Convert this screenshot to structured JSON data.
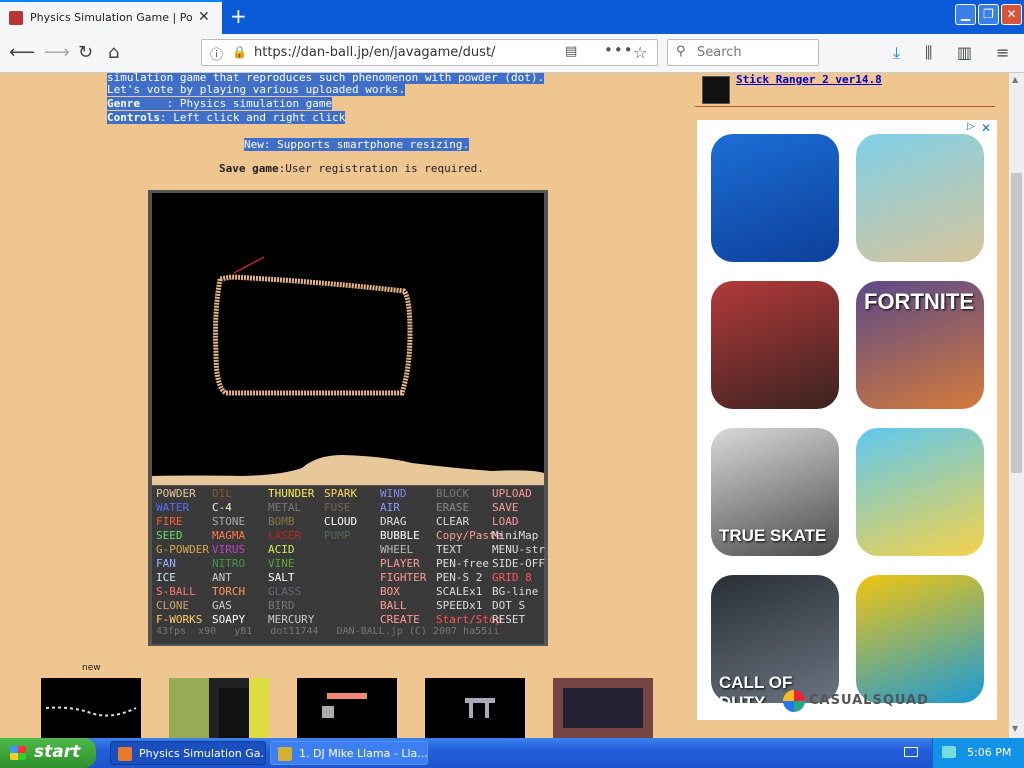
{
  "browser": {
    "tab_title": "Physics Simulation Game | Powder",
    "url": "https://dan-ball.jp/en/javagame/dust/",
    "search_placeholder": "Search"
  },
  "page": {
    "intro_line0": "simulation game that reproduces such phenomenon with powder (dot).",
    "intro_line1": "Let's vote by playing various uploaded works.",
    "genre_label": "Genre    ",
    "genre_value": ": Physics simulation game",
    "controls_label": "Controls",
    "controls_value": ": Left click and right click",
    "new_label": "New",
    "new_value": ": Supports smartphone resizing.",
    "save_label": "Save game",
    "save_value": ":User registration is required.",
    "thumbs_new_label": "new",
    "sidebar_link": "Stick Ranger 2 ver14.8"
  },
  "game": {
    "palette_columns": [
      [
        {
          "label": "POWDER",
          "color": "#e8c79a"
        },
        {
          "label": "WATER",
          "color": "#5a6cff"
        },
        {
          "label": "FIRE",
          "color": "#ff5a3a"
        },
        {
          "label": "SEED",
          "color": "#66dd66"
        },
        {
          "label": "G-POWDER",
          "color": "#d6a84a"
        },
        {
          "label": "FAN",
          "color": "#9ab0ff"
        },
        {
          "label": "ICE",
          "color": "#d6e8ff"
        },
        {
          "label": "S-BALL",
          "color": "#ff7777"
        },
        {
          "label": "CLONE",
          "color": "#d0a070"
        },
        {
          "label": "F-WORKS",
          "color": "#ffcc66"
        }
      ],
      [
        {
          "label": "OIL",
          "color": "#8a5a2a"
        },
        {
          "label": "C-4",
          "color": "#f0f0d0"
        },
        {
          "label": "STONE",
          "color": "#aaaaaa"
        },
        {
          "label": "MAGMA",
          "color": "#ff7744"
        },
        {
          "label": "VIRUS",
          "color": "#bb44bb"
        },
        {
          "label": "NITRO",
          "color": "#449944"
        },
        {
          "label": "ANT",
          "color": "#cccccc"
        },
        {
          "label": "TORCH",
          "color": "#ff9955"
        },
        {
          "label": "GAS",
          "color": "#cccccc"
        },
        {
          "label": "SOAPY",
          "color": "#ffffff"
        }
      ],
      [
        {
          "label": "THUNDER",
          "color": "#ffee55"
        },
        {
          "label": "METAL",
          "color": "#777777"
        },
        {
          "label": "BOMB",
          "color": "#887744"
        },
        {
          "label": "LASER",
          "color": "#bb2222"
        },
        {
          "label": "ACID",
          "color": "#ccee55"
        },
        {
          "label": "VINE",
          "color": "#55aa33"
        },
        {
          "label": "SALT",
          "color": "#ffffff"
        },
        {
          "label": "GLASS",
          "color": "#666677"
        },
        {
          "label": "BIRD",
          "color": "#777777"
        },
        {
          "label": "MERCURY",
          "color": "#cccccc"
        }
      ],
      [
        {
          "label": "SPARK",
          "color": "#ffdd55"
        },
        {
          "label": "FUSE",
          "color": "#776655"
        },
        {
          "label": "CLOUD",
          "color": "#ffffff"
        },
        {
          "label": "PUMP",
          "color": "#556655"
        }
      ],
      [
        {
          "label": "WIND",
          "color": "#8888ee"
        },
        {
          "label": "AIR",
          "color": "#8899ff"
        },
        {
          "label": "DRAG",
          "color": "#dddddd"
        },
        {
          "label": "BUBBLE",
          "color": "#ffffff"
        },
        {
          "label": "WHEEL",
          "color": "#bbbbbb"
        },
        {
          "label": "PLAYER",
          "color": "#ff9999"
        },
        {
          "label": "FIGHTER",
          "color": "#ff9999"
        },
        {
          "label": "BOX",
          "color": "#ff9999"
        },
        {
          "label": "BALL",
          "color": "#ff9999"
        },
        {
          "label": "CREATE",
          "color": "#ff9999"
        }
      ],
      [
        {
          "label": "BLOCK",
          "color": "#777777"
        },
        {
          "label": "ERASE",
          "color": "#888888"
        },
        {
          "label": "CLEAR",
          "color": "#dddddd"
        },
        {
          "label": "Copy/Paste",
          "color": "#ff9999"
        },
        {
          "label": "TEXT",
          "color": "#dddddd"
        },
        {
          "label": "PEN-free",
          "color": "#dddddd"
        },
        {
          "label": "PEN-S 2",
          "color": "#dddddd"
        },
        {
          "label": "SCALEx1",
          "color": "#dddddd"
        },
        {
          "label": "SPEEDx1",
          "color": "#dddddd"
        },
        {
          "label": "Start/Stop",
          "color": "#ff5555"
        }
      ],
      [
        {
          "label": "UPLOAD",
          "color": "#ff9999"
        },
        {
          "label": "SAVE",
          "color": "#ff9999"
        },
        {
          "label": "LOAD",
          "color": "#ff9999"
        },
        {
          "label": "MiniMap",
          "color": "#dddddd"
        },
        {
          "label": "MENU-str",
          "color": "#dddddd"
        },
        {
          "label": "SIDE-OFF",
          "color": "#dddddd"
        },
        {
          "label": "GRID 8",
          "color": "#ff5555"
        },
        {
          "label": "BG-line",
          "color": "#dddddd"
        },
        {
          "label": "DOT S",
          "color": "#dddddd"
        },
        {
          "label": "RESET",
          "color": "#dddddd"
        }
      ]
    ],
    "status_text": "43fps  x90   y81   dot11744   DAN-BALL.jp (C) 2007 ha55ii"
  },
  "ad": {
    "footer_brand": "CASUALSQUAD",
    "apps": [
      {
        "name": "huggy-wuggy-icon",
        "label": ""
      },
      {
        "name": "chicken-pixel-icon",
        "label": ""
      },
      {
        "name": "scary-teacher-icon",
        "label": ""
      },
      {
        "name": "fortnite-icon",
        "label": "FORTNITE"
      },
      {
        "name": "true-skate-icon",
        "label": "TRUE SKATE"
      },
      {
        "name": "pull-pin-icon",
        "label": ""
      },
      {
        "name": "call-of-duty-icon",
        "label": "CALL OF DUTY"
      },
      {
        "name": "geometry-dash-icon",
        "label": ""
      }
    ]
  },
  "taskbar": {
    "start_label": "start",
    "task1": "Physics Simulation Ga...",
    "task2": "1. DJ Mike Llama - Lla...",
    "clock": "5:06 PM"
  }
}
